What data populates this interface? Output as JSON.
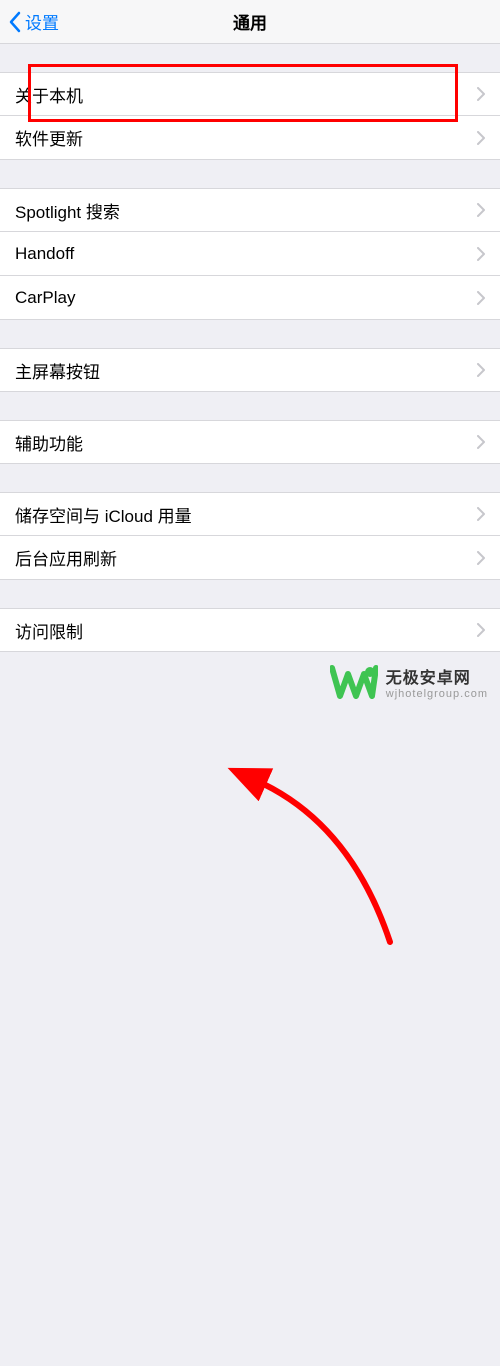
{
  "header": {
    "back_label": "设置",
    "title": "通用"
  },
  "groups": [
    {
      "gap": "section-gap",
      "rows": [
        {
          "key": "about",
          "label": "关于本机"
        },
        {
          "key": "software-update",
          "label": "软件更新"
        }
      ]
    },
    {
      "gap": "section-gap",
      "rows": [
        {
          "key": "spotlight",
          "label": "Spotlight 搜索"
        },
        {
          "key": "handoff",
          "label": "Handoff"
        },
        {
          "key": "carplay",
          "label": "CarPlay"
        }
      ]
    },
    {
      "gap": "section-gap",
      "rows": [
        {
          "key": "home-button",
          "label": "主屏幕按钮"
        }
      ]
    },
    {
      "gap": "section-gap",
      "rows": [
        {
          "key": "accessibility",
          "label": "辅助功能"
        }
      ]
    },
    {
      "gap": "section-gap",
      "rows": [
        {
          "key": "storage-icloud",
          "label": "储存空间与 iCloud 用量"
        },
        {
          "key": "background-refresh",
          "label": "后台应用刷新"
        }
      ]
    },
    {
      "gap": "section-gap",
      "rows": [
        {
          "key": "restrictions",
          "label": "访问限制"
        }
      ]
    }
  ],
  "annotation": {
    "highlight_row_key": "about",
    "color": "#ff0000"
  },
  "watermark": {
    "title": "无极安卓网",
    "sub": "wjhotelgroup.com"
  }
}
